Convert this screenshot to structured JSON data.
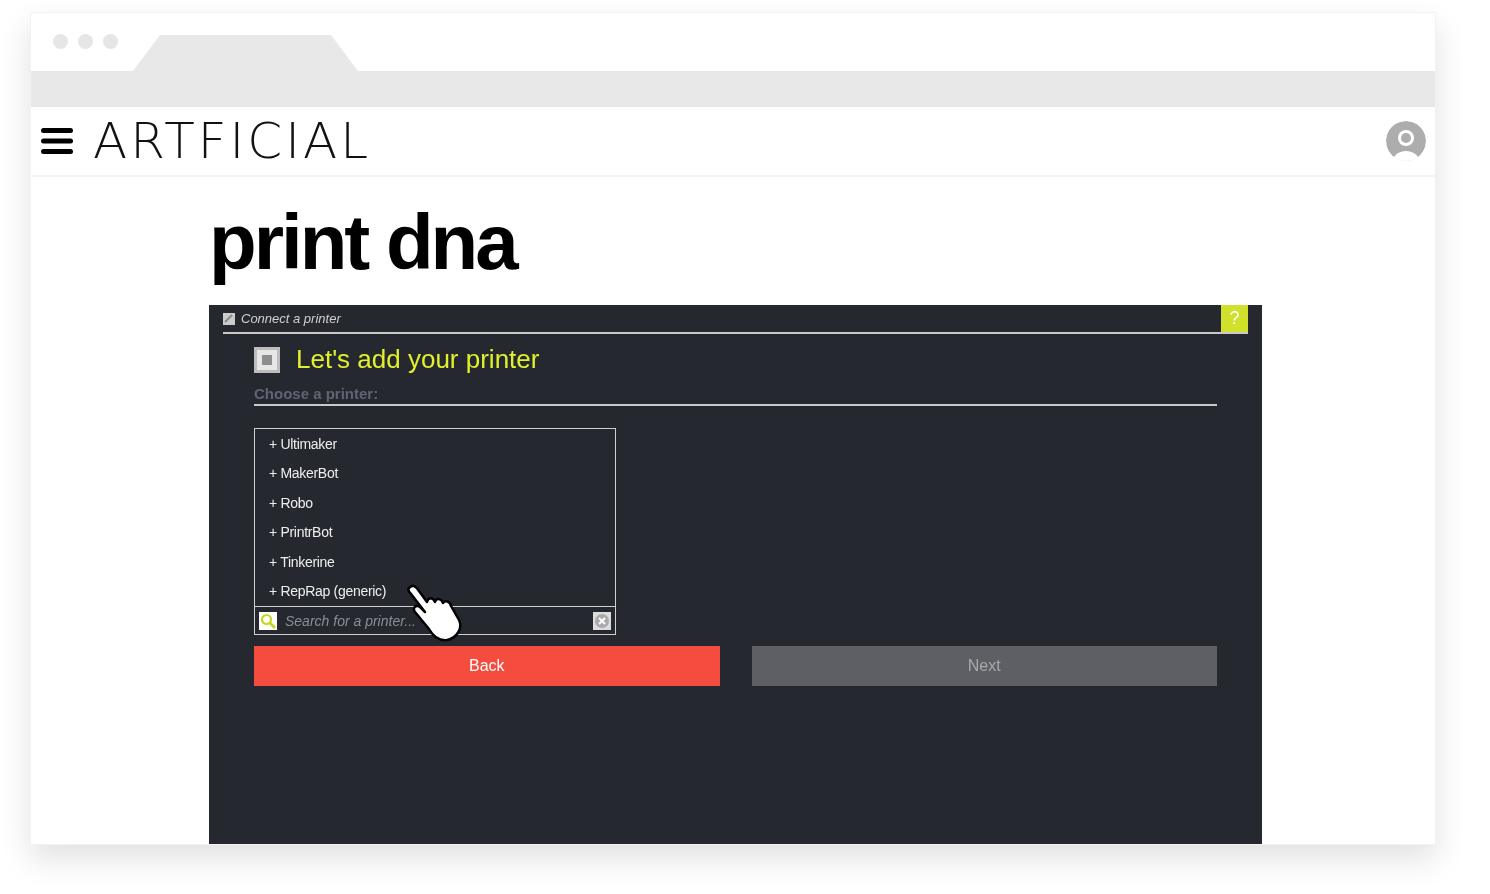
{
  "site": {
    "logo": "ARTFICIAL"
  },
  "page": {
    "title": "print dna"
  },
  "dialog": {
    "title": "Connect a printer",
    "help": "?",
    "heading": "Let's add your printer",
    "subheading": "Choose a printer:",
    "printers": [
      {
        "label": "+ Ultimaker"
      },
      {
        "label": "+ MakerBot"
      },
      {
        "label": "+ Robo"
      },
      {
        "label": "+ PrintrBot"
      },
      {
        "label": "+ Tinkerine"
      },
      {
        "label": "+ RepRap (generic)"
      }
    ],
    "search": {
      "placeholder": "Search for a printer..."
    },
    "buttons": [
      {
        "label": "Back",
        "disabled": false
      },
      {
        "label": "Next",
        "disabled": true
      }
    ]
  }
}
